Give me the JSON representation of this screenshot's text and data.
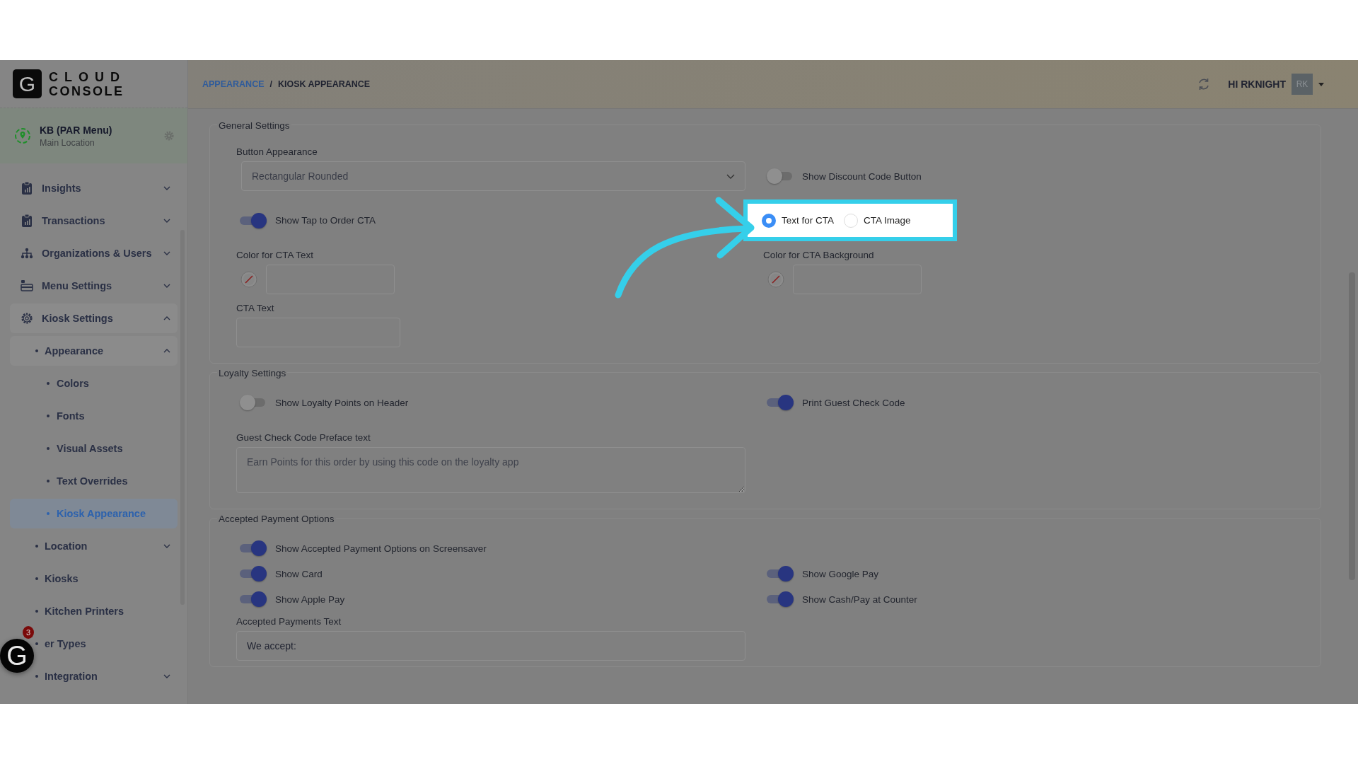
{
  "logo": {
    "mark": "G",
    "line1": "CLOUD",
    "line2": "CONSOLE"
  },
  "location": {
    "name": "KB (PAR Menu)",
    "subtitle": "Main Location"
  },
  "nav": [
    {
      "label": "Insights",
      "kind": "group",
      "expanded": false,
      "selected": false
    },
    {
      "label": "Transactions",
      "kind": "group",
      "expanded": false,
      "selected": false
    },
    {
      "label": "Organizations & Users",
      "kind": "group",
      "expanded": false,
      "selected": false
    },
    {
      "label": "Menu Settings",
      "kind": "group",
      "expanded": false,
      "selected": false
    },
    {
      "label": "Kiosk Settings",
      "kind": "group",
      "expanded": true,
      "selected": false,
      "children": [
        {
          "label": "Appearance",
          "kind": "group",
          "expanded": true,
          "selected": false,
          "children": [
            {
              "label": "Colors",
              "kind": "link",
              "selected": false
            },
            {
              "label": "Fonts",
              "kind": "link",
              "selected": false
            },
            {
              "label": "Visual Assets",
              "kind": "link",
              "selected": false
            },
            {
              "label": "Text Overrides",
              "kind": "link",
              "selected": false
            },
            {
              "label": "Kiosk Appearance",
              "kind": "link",
              "selected": true
            }
          ]
        },
        {
          "label": "Location",
          "kind": "group",
          "expanded": false,
          "selected": false
        },
        {
          "label": "Kiosks",
          "kind": "link",
          "selected": false
        },
        {
          "label": "Kitchen Printers",
          "kind": "link",
          "selected": false
        },
        {
          "label": "er Types",
          "kind": "link",
          "selected": false
        },
        {
          "label": "Integration",
          "kind": "group",
          "expanded": false,
          "selected": false
        }
      ]
    }
  ],
  "chat": {
    "mark": "G",
    "badge": "3"
  },
  "breadcrumb": [
    {
      "label": "APPEARANCE",
      "kind": "link"
    },
    {
      "label": "/",
      "kind": "separator"
    },
    {
      "label": "KIOSK APPEARANCE",
      "kind": "current"
    }
  ],
  "user": {
    "greeting": "HI RKNIGHT",
    "initials": "RK"
  },
  "general": {
    "title": "General Settings",
    "button_appearance": {
      "label": "Button Appearance",
      "value": "Rectangular Rounded"
    },
    "show_discount": {
      "label": "Show Discount Code Button",
      "on": false
    },
    "show_tap": {
      "label": "Show Tap to Order CTA",
      "on": true
    },
    "cta_type": [
      {
        "label": "Text for CTA",
        "selected": true
      },
      {
        "label": "CTA Image",
        "selected": false
      }
    ],
    "cta_text_color": {
      "label": "Color for CTA Text"
    },
    "cta_bg_color": {
      "label": "Color for CTA Background"
    },
    "cta_text": {
      "label": "CTA Text"
    }
  },
  "loyalty": {
    "title": "Loyalty Settings",
    "toggles": [
      {
        "label": "Show Loyalty Points on Header",
        "on": false
      },
      {
        "label": "Print Guest Check Code",
        "on": true
      }
    ],
    "preface": {
      "label": "Guest Check Code Preface text",
      "placeholder": "Earn Points for this order by using this code on the loyalty app"
    }
  },
  "payment": {
    "title": "Accepted Payment Options",
    "toggles": [
      {
        "label": "Show Accepted Payment Options on Screensaver",
        "on": true
      },
      {
        "label": "Show Card",
        "on": true
      },
      {
        "label": "Show Google Pay",
        "on": true
      },
      {
        "label": "Show Apple Pay",
        "on": true
      },
      {
        "label": "Show Cash/Pay at Counter",
        "on": true
      }
    ],
    "text": {
      "label": "Accepted Payments Text",
      "value": "We accept:"
    }
  }
}
